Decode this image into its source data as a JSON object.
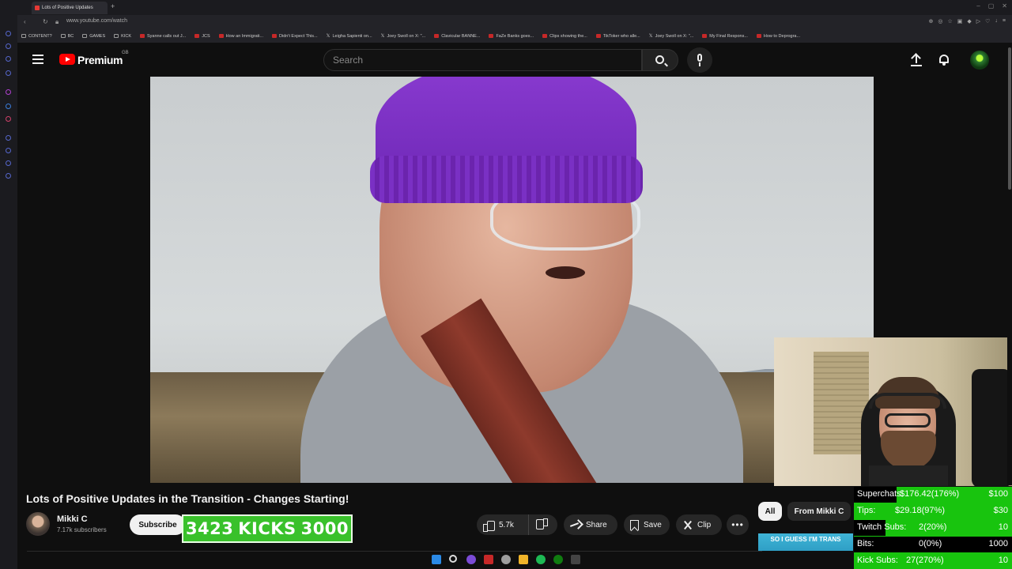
{
  "browser": {
    "tab_title": "Lots of Positive Updates",
    "url": "www.youtube.com/watch",
    "bookmarks": [
      {
        "label": "CONTENT?",
        "kind": "folder"
      },
      {
        "label": "BC",
        "kind": "folder"
      },
      {
        "label": "GAMES",
        "kind": "folder"
      },
      {
        "label": "KICK",
        "kind": "folder"
      },
      {
        "label": "Syanne calls out J...",
        "kind": "site"
      },
      {
        "label": "JCS",
        "kind": "site"
      },
      {
        "label": "How an Immigrati...",
        "kind": "site"
      },
      {
        "label": "Didn't Expect This...",
        "kind": "site"
      },
      {
        "label": "Leigha Sapienti on...",
        "kind": "x"
      },
      {
        "label": "Joey Swoll on X: \"...",
        "kind": "x"
      },
      {
        "label": "Clavicular BANNE...",
        "kind": "site"
      },
      {
        "label": "FaZe Banks goes...",
        "kind": "site"
      },
      {
        "label": "Clips showing the...",
        "kind": "site"
      },
      {
        "label": "TikToker who alle...",
        "kind": "site"
      },
      {
        "label": "Joey Swoll on X: \"...",
        "kind": "x"
      },
      {
        "label": "My Final Respons...",
        "kind": "site"
      },
      {
        "label": "How to Deprogra...",
        "kind": "site"
      }
    ]
  },
  "header": {
    "brand": "Premium",
    "region": "GB",
    "search_placeholder": "Search"
  },
  "video": {
    "title": "Lots of Positive Updates in the Transition - Changes Starting!",
    "channel_name": "Mikki C",
    "subscribers": "7.17k subscribers",
    "subscribe_label": "Subscribe",
    "likes": "5.7k",
    "share_label": "Share",
    "save_label": "Save",
    "clip_label": "Clip",
    "more_label": "•••"
  },
  "kicks_overlay": {
    "current": "3423",
    "label": "KICKS",
    "goal": "3000"
  },
  "chips": {
    "all": "All",
    "from": "From Mikki C"
  },
  "thumbnail_text": "SO I GUESS I'M TRANS",
  "stats": [
    {
      "label": "Superchats:",
      "value": "$176.42(176%)",
      "goal": "$100",
      "fraction": 0.27
    },
    {
      "label": "Tips:",
      "value": "$29.18(97%)",
      "goal": "$30",
      "fraction": 0.0
    },
    {
      "label": "Twitch Subs:",
      "value": "2(20%)",
      "goal": "10",
      "fraction": 0.2
    },
    {
      "label": "Bits:",
      "value": "0(0%)",
      "goal": "1000",
      "fraction": 1.0
    },
    {
      "label": "Kick Subs:",
      "value": "27(270%)",
      "goal": "10",
      "fraction": 0.0
    }
  ],
  "colors": {
    "yt_red": "#ff0000",
    "kick_green": "#39c12b",
    "stats_green": "#18c40e"
  }
}
